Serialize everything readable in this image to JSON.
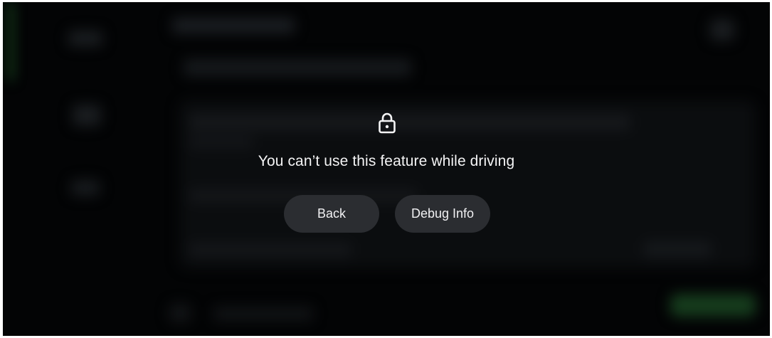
{
  "background_app": {
    "accent_color": "#1e5a26",
    "action_color": "#163c1d"
  },
  "overlay": {
    "icon": "lock-icon",
    "message": "You can’t use this feature while driving",
    "buttons": {
      "back_label": "Back",
      "debug_label": "Debug Info"
    }
  }
}
